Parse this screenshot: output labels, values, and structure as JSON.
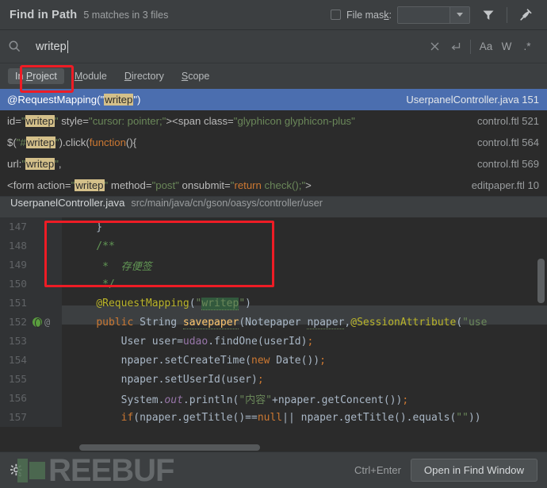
{
  "header": {
    "title": "Find in Path",
    "subtitle": "5 matches in 3 files",
    "file_mask_label": "File mask:",
    "file_mask_value": "",
    "filter_icon": "filter-icon",
    "pin_icon": "pin-icon"
  },
  "search": {
    "value": "writep",
    "placeholder": "",
    "icon": "search-icon",
    "clear_label": "✕",
    "newline_label": "↵",
    "match_case_label": "Aa",
    "words_label": "W",
    "regex_label": ".*"
  },
  "scope": {
    "tabs": [
      {
        "label": "In Project",
        "pre": "In ",
        "accel": "P",
        "post": "roject",
        "selected": true
      },
      {
        "label": "Module",
        "pre": "",
        "accel": "M",
        "post": "odule",
        "selected": false
      },
      {
        "label": "Directory",
        "pre": "",
        "accel": "D",
        "post": "irectory",
        "selected": false
      },
      {
        "label": "Scope",
        "pre": "",
        "accel": "S",
        "post": "cope",
        "selected": false
      }
    ]
  },
  "results": [
    {
      "selected": true,
      "text": "@RequestMapping(\"writep\")",
      "file": "UserpanelController.java",
      "line": "151",
      "location": "UserpanelController.java 151"
    },
    {
      "selected": false,
      "text": "id=\"writep\" style=\"cursor: pointer;\"><span class=\"glyphicon glyphicon-plus\"",
      "file": "control.ftl",
      "line": "521",
      "location": "control.ftl 521"
    },
    {
      "selected": false,
      "text": "$(\"#writep\").click(function(){",
      "file": "control.ftl",
      "line": "564",
      "location": "control.ftl 564"
    },
    {
      "selected": false,
      "text": "url:\"writep\",",
      "file": "control.ftl",
      "line": "569",
      "location": "control.ftl 569"
    },
    {
      "selected": false,
      "text": "<form action=\"writep\" method=\"post\" onsubmit=\"return check();\">",
      "file": "editpaper.ftl",
      "line": "10",
      "location": "editpaper.ftl 10"
    }
  ],
  "path_bar": {
    "file_name": "UserpanelController.java",
    "directory": "src/main/java/cn/gson/oasys/controller/user"
  },
  "code": {
    "lines": [
      {
        "num": "147",
        "text": "}"
      },
      {
        "num": "148",
        "text": "/**"
      },
      {
        "num": "149",
        "text": " * 存便签"
      },
      {
        "num": "150",
        "text": " */"
      },
      {
        "num": "151",
        "text": "@RequestMapping(\"writep\")"
      },
      {
        "num": "152",
        "text": "public String savepaper(Notepaper npaper,@SessionAttribute(\"use",
        "gutter_icons": [
          "web-globe-icon",
          "at-icon"
        ]
      },
      {
        "num": "153",
        "text": "    User user=udao.findOne(userId);"
      },
      {
        "num": "154",
        "text": "    npaper.setCreateTime(new Date());"
      },
      {
        "num": "155",
        "text": "    npaper.setUserId(user);"
      },
      {
        "num": "156",
        "text": "    System.out.println(\"内容\"+npaper.getConcent());"
      },
      {
        "num": "157",
        "text": "    if(npaper.getTitle()==null|| npaper.getTitle().equals(\"\"))"
      }
    ]
  },
  "footer": {
    "gear_icon": "gear-icon",
    "shortcut": "Ctrl+Enter",
    "open_button": "Open in Find Window",
    "watermark": "REEBUF"
  },
  "colors": {
    "window_bg": "#3c3f41",
    "editor_bg": "#2b2b2b",
    "selection_blue": "#4b6eaf",
    "match_highlight": "#d4c08a",
    "annotation_red": "#ee1c25",
    "string_green": "#6a8759",
    "keyword_orange": "#cc7832"
  }
}
